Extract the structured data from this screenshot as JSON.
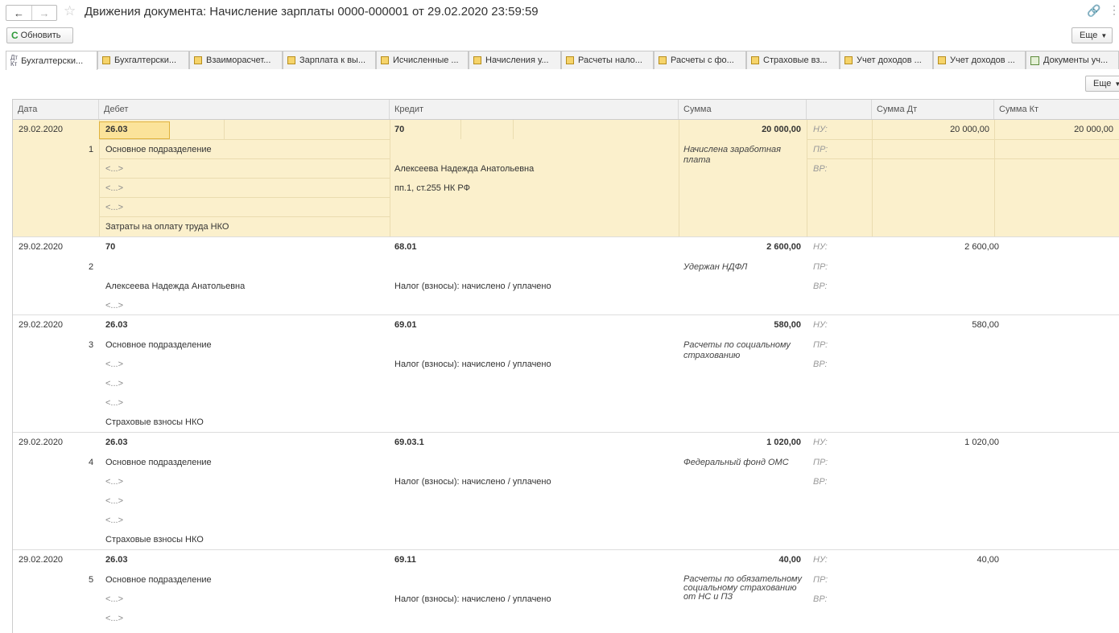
{
  "window": {
    "title": "Движения документа: Начисление зарплаты 0000-000001 от 29.02.2020 23:59:59",
    "back": "←",
    "forward": "→"
  },
  "toolbar": {
    "refresh_label": "Обновить",
    "more_label": "Еще"
  },
  "tabs": [
    {
      "label": "Бухгалтерски...",
      "icon": "accounting-dt-kt-icon"
    },
    {
      "label": "Бухгалтерски...",
      "icon": "register-icon"
    },
    {
      "label": "Взаиморасчет...",
      "icon": "register-icon"
    },
    {
      "label": "Зарплата к вы...",
      "icon": "register-icon"
    },
    {
      "label": "Исчисленные ...",
      "icon": "register-icon"
    },
    {
      "label": "Начисления у...",
      "icon": "register-icon"
    },
    {
      "label": "Расчеты нало...",
      "icon": "register-icon"
    },
    {
      "label": "Расчеты с фо...",
      "icon": "register-icon"
    },
    {
      "label": "Страховые вз...",
      "icon": "register-icon"
    },
    {
      "label": "Учет доходов ...",
      "icon": "register-icon"
    },
    {
      "label": "Учет доходов ...",
      "icon": "register-icon"
    },
    {
      "label": "Документы уч...",
      "icon": "document-grid-icon"
    }
  ],
  "table": {
    "more_label": "Еще",
    "columns": {
      "date": "Дата",
      "debit": "Дебет",
      "credit": "Кредит",
      "sum": "Сумма",
      "extra": "",
      "sum_dt": "Сумма Дт",
      "sum_kt": "Сумма Кт"
    },
    "labels": {
      "nu": "НУ:",
      "pr": "ПР:",
      "vr": "ВР:"
    },
    "entries": [
      {
        "date": "29.02.2020",
        "num": "1",
        "debit": "26.03",
        "debit_lines": [
          "Основное подразделение",
          "<...>",
          "<...>",
          "<...>",
          "Затраты на оплату труда НКО"
        ],
        "credit": "70",
        "credit_lines": [
          "",
          "Алексеева Надежда Анатольевна",
          "пп.1, ст.255 НК РФ"
        ],
        "sum": "20 000,00",
        "content": "Начислена заработная плата",
        "sum_dt": "20 000,00",
        "sum_kt": "20 000,00"
      },
      {
        "date": "29.02.2020",
        "num": "2",
        "debit": "70",
        "debit_lines": [
          "",
          "Алексеева Надежда Анатольевна",
          "<...>"
        ],
        "credit": "68.01",
        "credit_lines": [
          "",
          "Налог (взносы): начислено / уплачено"
        ],
        "sum": "2 600,00",
        "content": "Удержан НДФЛ",
        "sum_dt": "2 600,00",
        "sum_kt": ""
      },
      {
        "date": "29.02.2020",
        "num": "3",
        "debit": "26.03",
        "debit_lines": [
          "Основное подразделение",
          "<...>",
          "<...>",
          "<...>",
          "Страховые взносы НКО"
        ],
        "credit": "69.01",
        "credit_lines": [
          "",
          "Налог (взносы): начислено / уплачено"
        ],
        "sum": "580,00",
        "content": "Расчеты по социальному страхованию",
        "sum_dt": "580,00",
        "sum_kt": ""
      },
      {
        "date": "29.02.2020",
        "num": "4",
        "debit": "26.03",
        "debit_lines": [
          "Основное подразделение",
          "<...>",
          "<...>",
          "<...>",
          "Страховые взносы НКО"
        ],
        "credit": "69.03.1",
        "credit_lines": [
          "",
          "Налог (взносы): начислено / уплачено"
        ],
        "sum": "1 020,00",
        "content": "Федеральный фонд ОМС",
        "sum_dt": "1 020,00",
        "sum_kt": ""
      },
      {
        "date": "29.02.2020",
        "num": "5",
        "debit": "26.03",
        "debit_lines": [
          "Основное подразделение",
          "<...>",
          "<...>"
        ],
        "credit": "69.11",
        "credit_lines": [
          "",
          "Налог (взносы): начислено / уплачено"
        ],
        "sum": "40,00",
        "content": "Расчеты по обязательному социальному страхованию от НС и ПЗ",
        "sum_dt": "40,00",
        "sum_kt": ""
      }
    ]
  }
}
